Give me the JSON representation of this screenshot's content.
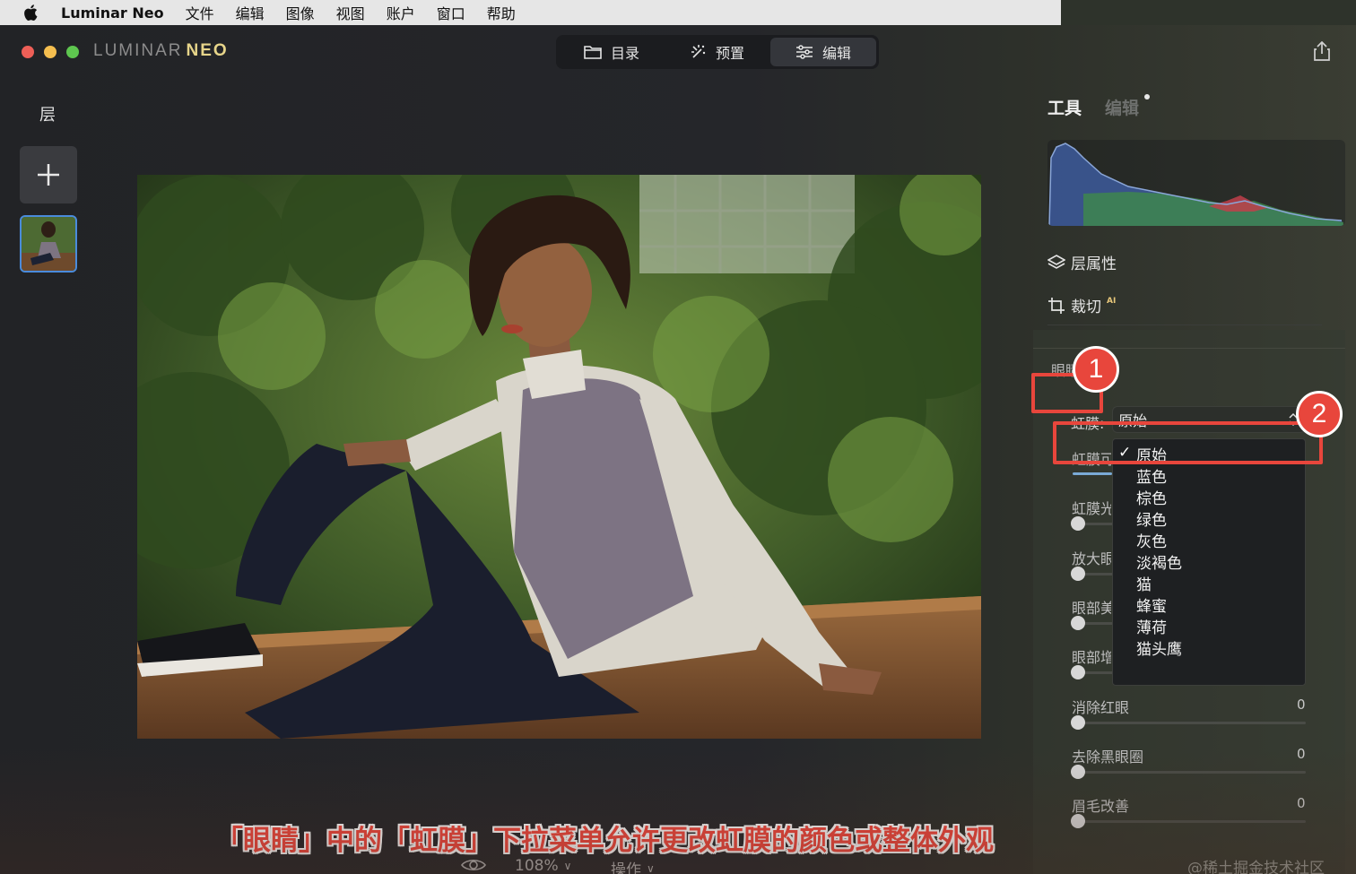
{
  "menubar": {
    "app_name": "Luminar Neo",
    "items": [
      "文件",
      "编辑",
      "图像",
      "视图",
      "账户",
      "窗口",
      "帮助"
    ]
  },
  "window": {
    "logo_text": "LUMINAR",
    "logo_accent": "NEO",
    "tabs": [
      {
        "label": "目录",
        "icon": "folder-icon"
      },
      {
        "label": "预置",
        "icon": "sparkle-icon"
      },
      {
        "label": "编辑",
        "icon": "sliders-icon",
        "active": true
      }
    ]
  },
  "layers": {
    "title": "层",
    "add_icon": "plus-icon"
  },
  "right_panel": {
    "tab_tools": "工具",
    "tab_edit": "编辑",
    "layer_properties": "层属性",
    "crop": "裁切",
    "crop_badge": "AI",
    "eyes_section": "眼睛",
    "iris_label": "虹膜:",
    "iris_value": "原始",
    "iris_options": [
      "原始",
      "蓝色",
      "棕色",
      "绿色",
      "灰色",
      "淡褐色",
      "猫",
      "蜂蜜",
      "薄荷",
      "猫头鹰"
    ],
    "iris_selected_index": 0,
    "hidden_sliders": [
      {
        "label": "虹膜可"
      },
      {
        "label": "虹膜光"
      },
      {
        "label": "放大眼"
      },
      {
        "label": "眼部美"
      },
      {
        "label": "眼部增"
      }
    ],
    "sliders": [
      {
        "label": "消除红眼",
        "value": "0"
      },
      {
        "label": "去除黑眼圈",
        "value": "0"
      },
      {
        "label": "眉毛改善",
        "value": "0"
      }
    ]
  },
  "annotations": {
    "marker_1": "1",
    "marker_2": "2",
    "caption": "「眼睛」中的「虹膜」下拉菜单允许更改虹膜的颜色或整体外观"
  },
  "bottom_bar": {
    "zoom": "108%",
    "actions": "操作"
  },
  "watermark": "@稀土掘金技术社区",
  "colors": {
    "annotation_red": "#e8463c",
    "active_tab_bg": "#34363b",
    "logo_accent": "#e7d58a",
    "layer_selection": "#4a8bdc"
  }
}
